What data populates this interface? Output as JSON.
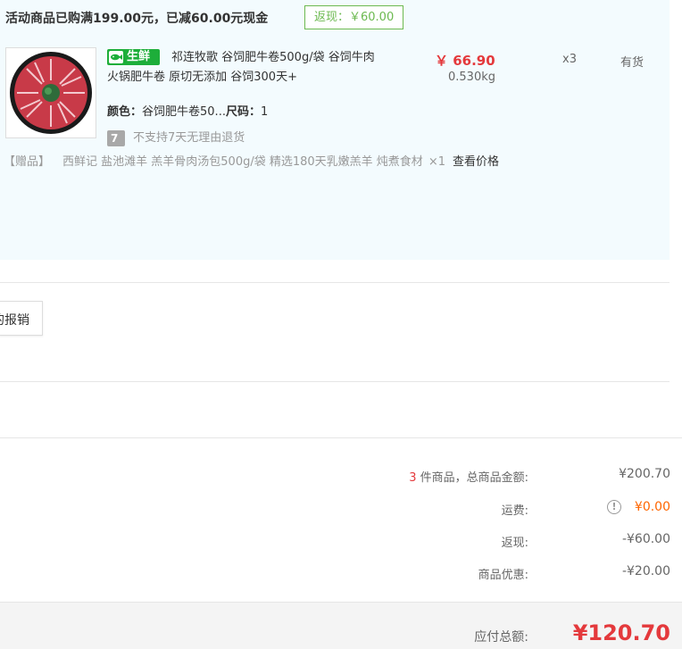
{
  "promo": {
    "text": "活动商品已购满199.00元，已减60.00元现金",
    "rebate_tag": "返现：￥60.00"
  },
  "product": {
    "badge": "生鲜",
    "badge_icon": "fish-icon",
    "title": "祁连牧歌 谷饲肥牛卷500g/袋 谷饲牛肉 火锅肥牛卷 原切无添加 谷饲300天+",
    "price": "￥ 66.90",
    "weight": "0.530kg",
    "qty": "x3",
    "stock": "有货",
    "color_label": "颜色：",
    "color_value": "谷饲肥牛卷50...",
    "size_label": "尺码：",
    "size_value": "1",
    "return_badge": "7",
    "return_text": "不支持7天无理由退货"
  },
  "gift": {
    "tag": "【赠品】",
    "name": "西鲜记 盐池滩羊 羔羊骨肉汤包500g/袋 精选180天乳嫩羔羊 炖煮食材",
    "qty": "×1",
    "link": "查看价格"
  },
  "invoice": {
    "button_label": "的报销"
  },
  "summary": {
    "count": "3",
    "count_suffix": " 件商品，总商品金额:",
    "goods_amount": "¥200.70",
    "shipping_label": "运费:",
    "shipping_amount": "¥0.00",
    "rebate_label": "返现:",
    "rebate_amount": "-¥60.00",
    "discount_label": "商品优惠:",
    "discount_amount": "-¥20.00",
    "total_label": "应付总额:",
    "total_amount": "¥120.70"
  },
  "colors": {
    "accent_red": "#e4393c",
    "fresh_green": "#1dae3a",
    "rebate_green": "#6cb950",
    "shipping_orange": "#ff6600",
    "panel_bg": "#f3fbfe"
  }
}
